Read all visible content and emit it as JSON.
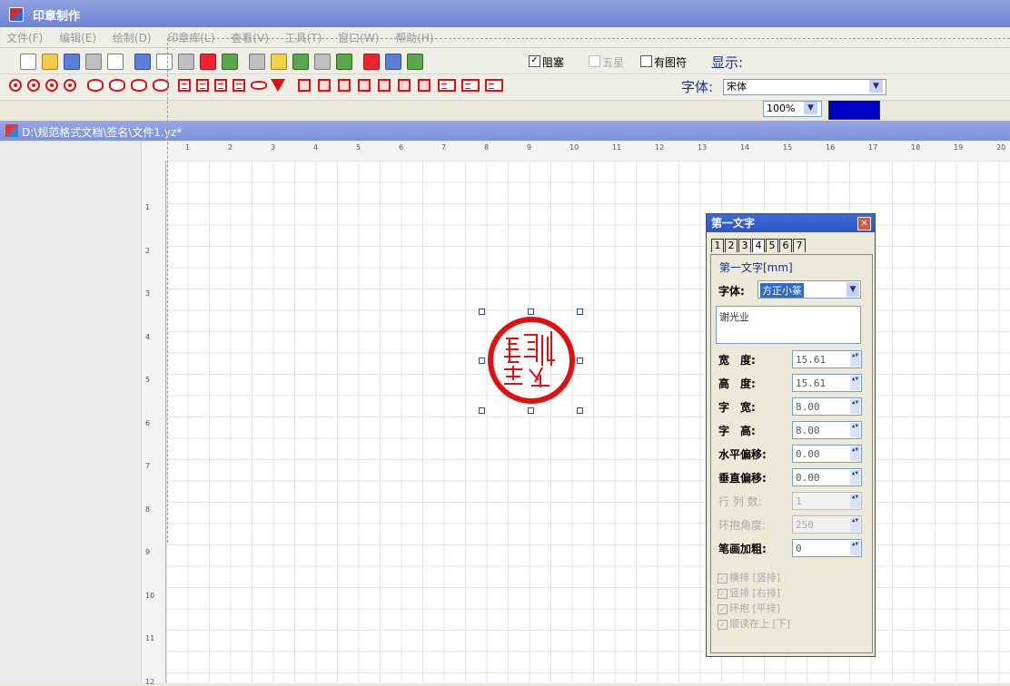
{
  "window": {
    "title": "印章制作"
  },
  "menu": [
    "文件(F)",
    "编辑(E)",
    "绘制(D)",
    "印章库(L)",
    "查看(V)",
    "工具(T)",
    "窗口(W)",
    "帮助(H)"
  ],
  "toolbar": {
    "chk_overlap": "阻塞",
    "chk_star": "五星",
    "chk_image": "有图符",
    "display_label": "显示:",
    "zoom_value": "100%",
    "font_label": "字体:",
    "font_value": "宋体",
    "color": "#0000c8"
  },
  "document": {
    "path": "D:\\规范格式文档\\签名\\文件1.yz*"
  },
  "ruler": {
    "h": [
      "1",
      "2",
      "3",
      "4",
      "5",
      "6",
      "7",
      "8",
      "9",
      "10",
      "11",
      "12",
      "13",
      "14",
      "15",
      "16",
      "17",
      "18",
      "19",
      "20"
    ],
    "v": [
      "1",
      "2",
      "3",
      "4",
      "5",
      "6",
      "7",
      "8",
      "9",
      "10",
      "11",
      "12"
    ]
  },
  "seal": {
    "text": "谢光业",
    "color": "#e01010"
  },
  "panel": {
    "title": "第一文字",
    "tabs": [
      "1",
      "2",
      "3",
      "4",
      "5",
      "6",
      "7"
    ],
    "section": "第一文字[mm]",
    "font_label": "字体:",
    "font_value": "方正小篆",
    "text_value": "谢光业",
    "fields": [
      {
        "label": "宽　度:",
        "value": "15.61",
        "enabled": true
      },
      {
        "label": "高　度:",
        "value": "15.61",
        "enabled": true
      },
      {
        "label": "字　宽:",
        "value": "8.00",
        "enabled": true
      },
      {
        "label": "字　高:",
        "value": "8.00",
        "enabled": true
      },
      {
        "label": "水平偏移:",
        "value": "0.00",
        "enabled": true
      },
      {
        "label": "垂直偏移:",
        "value": "0.00",
        "enabled": true
      },
      {
        "label": "行 列 数:",
        "value": "1",
        "enabled": false
      },
      {
        "label": "环抱角度:",
        "value": "250",
        "enabled": false
      },
      {
        "label": "笔画加粗:",
        "value": "0",
        "enabled": true
      }
    ],
    "checkboxes": [
      "横排 [竖排]",
      "竖排 [右排]",
      "环抱 [平排]",
      "顺读在上 [下]"
    ]
  }
}
